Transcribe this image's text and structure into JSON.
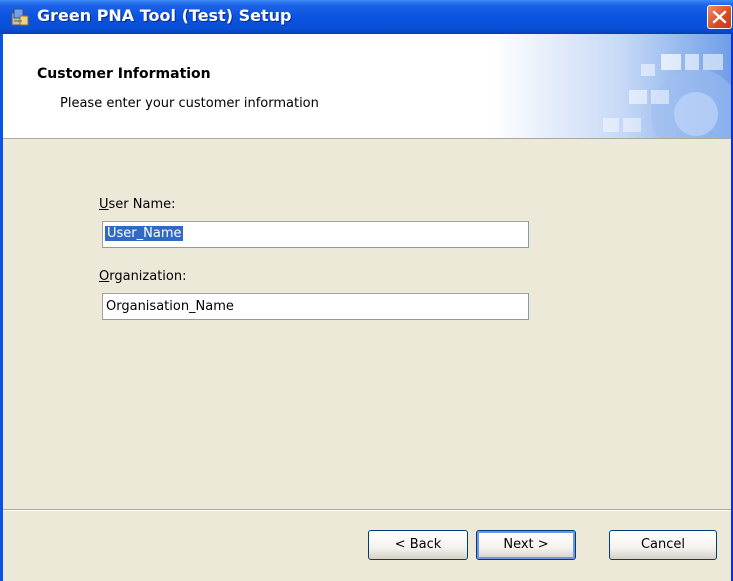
{
  "window": {
    "title": "Green PNA Tool (Test) Setup",
    "icon": "installer-icon",
    "close_icon": "close-icon"
  },
  "banner": {
    "title": "Customer Information",
    "subtitle": "Please enter your customer information"
  },
  "form": {
    "user_name": {
      "label_accel": "U",
      "label_rest": "ser Name:",
      "value": "User_Name",
      "selected": true
    },
    "organization": {
      "label_accel": "O",
      "label_rest": "rganization:",
      "value": "Organisation_Name"
    }
  },
  "buttons": {
    "back": "< Back",
    "next": "Next >",
    "cancel": "Cancel"
  },
  "colors": {
    "titlebar": "#0a52e0",
    "client_bg": "#ece9d8",
    "selection": "#316ac5",
    "close_button": "#d44b22"
  }
}
